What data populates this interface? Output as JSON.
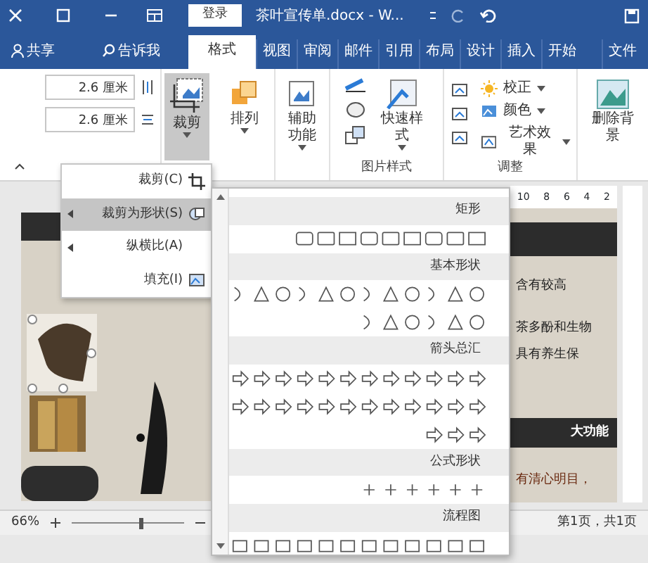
{
  "title_bar": {
    "title": "茶叶宣传单.docx - W...",
    "login_button": "登录"
  },
  "share": "共享",
  "tell_me": "告诉我",
  "tabs": [
    {
      "label": "格式",
      "selected": true
    },
    {
      "label": "视图",
      "selected": false
    },
    {
      "label": "审阅",
      "selected": false
    },
    {
      "label": "邮件",
      "selected": false
    },
    {
      "label": "引用",
      "selected": false
    },
    {
      "label": "布局",
      "selected": false
    },
    {
      "label": "设计",
      "selected": false
    },
    {
      "label": "插入",
      "selected": false
    },
    {
      "label": "开始",
      "selected": false
    },
    {
      "label": "文件",
      "selected": false
    }
  ],
  "ribbon": {
    "height_field": "2.6 厘米",
    "width_field": "2.6 厘米",
    "crop_button": "裁剪",
    "arrange": "排列",
    "accessibility": "辅助功能",
    "quick_styles": "快速样式",
    "picture_styles_group": "图片样式",
    "corrections": "校正",
    "color_button": "颜色",
    "artistic_effects": "艺术效果",
    "adjust_group": "调整",
    "remove_background": "删除背景"
  },
  "crop_menu": [
    {
      "label": "裁剪(C)",
      "selected": false,
      "submenu": false
    },
    {
      "label": "裁剪为形状(S)",
      "selected": true,
      "submenu": true
    },
    {
      "label": "纵横比(A)",
      "selected": false,
      "submenu": true
    },
    {
      "label": "填充(I)",
      "selected": false,
      "submenu": false
    }
  ],
  "shape_gallery": [
    {
      "title": "矩形"
    },
    {
      "title": "基本形状"
    },
    {
      "title": "箭头总汇"
    },
    {
      "title": "公式形状"
    },
    {
      "title": "流程图"
    }
  ],
  "ruler": [
    "10",
    "8",
    "6",
    "4",
    "2"
  ],
  "document_texts": [
    "含有较高",
    "茶多酚和生物",
    "具有养生保",
    "大功能",
    "有清心明目，"
  ],
  "status_bar": {
    "page": "第1页，共1页",
    "zoom": "66%",
    "zoom_slider": {
      "level": 0.62
    }
  }
}
